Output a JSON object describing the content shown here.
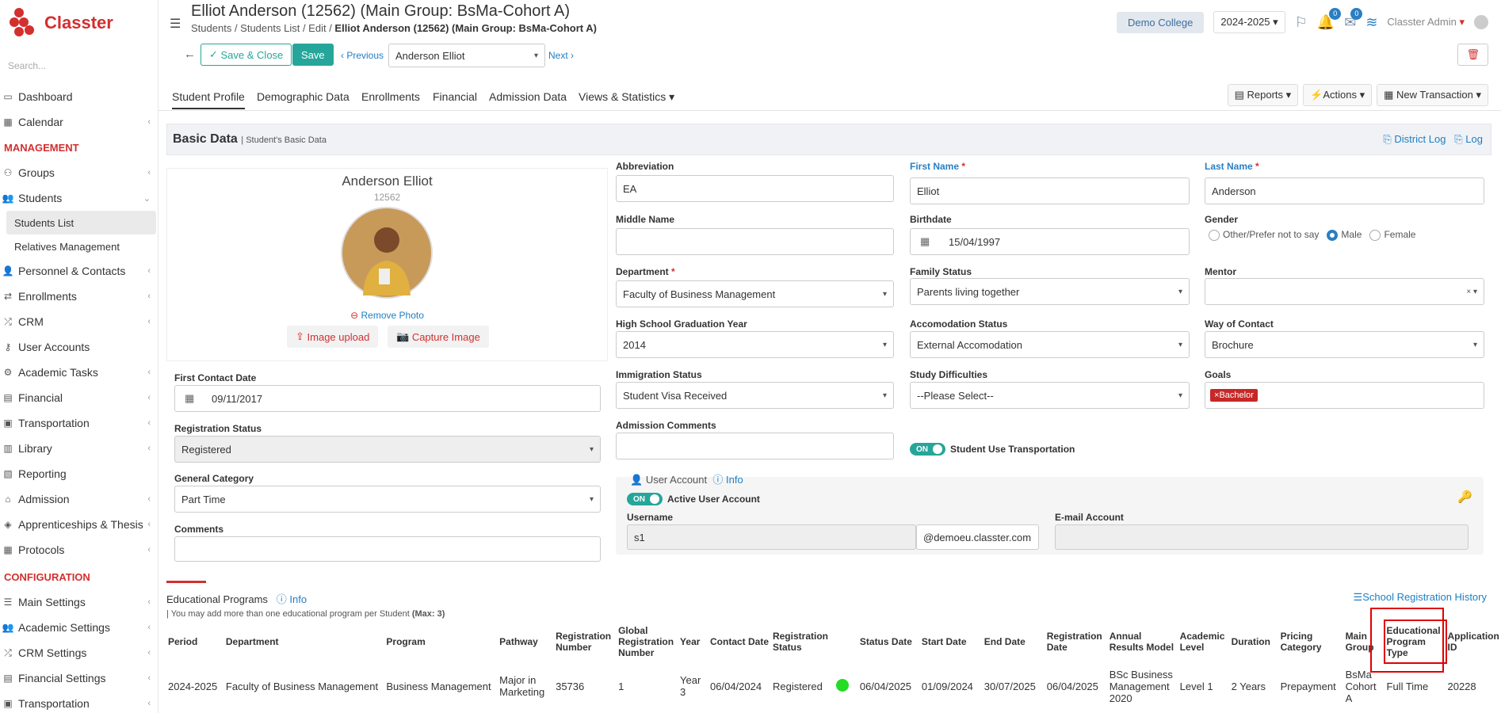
{
  "app": {
    "name": "Classter",
    "search_placeholder": "Search..."
  },
  "sidebar": {
    "items_top": [
      {
        "label": "Dashboard",
        "icon": "laptop-icon"
      },
      {
        "label": "Calendar",
        "icon": "calendar-icon"
      }
    ],
    "section1": "MANAGEMENT",
    "mgmt": [
      {
        "label": "Groups"
      },
      {
        "label": "Students"
      }
    ],
    "students_sub": [
      "Students List",
      "Relatives Management"
    ],
    "mgmt2": [
      "Personnel & Contacts",
      "Enrollments",
      "CRM",
      "User Accounts",
      "Academic Tasks",
      "Financial",
      "Transportation",
      "Library",
      "Reporting",
      "Admission",
      "Apprenticeships & Thesis",
      "Protocols"
    ],
    "section2": "CONFIGURATION",
    "config": [
      "Main Settings",
      "Academic Settings",
      "CRM Settings",
      "Financial Settings",
      "Transportation"
    ]
  },
  "header": {
    "title": "Elliot Anderson (12562) (Main Group: BsMa-Cohort A)",
    "crumbs": [
      "Students",
      "Students List",
      "Edit"
    ],
    "crumb_current": "Elliot Anderson (12562) (Main Group: BsMa-Cohort A)",
    "college": "Demo College",
    "year": "2024-2025",
    "notif1": "0",
    "notif2": "0",
    "user": "Classter Admin"
  },
  "toolbar": {
    "save_close": "Save & Close",
    "save": "Save",
    "previous": "Previous",
    "student": "Anderson Elliot",
    "next": "Next"
  },
  "tabs": [
    "Student Profile",
    "Demographic Data",
    "Enrollments",
    "Financial",
    "Admission Data",
    "Views & Statistics"
  ],
  "tab_buttons": [
    "Reports",
    "Actions",
    "New Transaction"
  ],
  "basic": {
    "title": "Basic Data",
    "subtitle": "| Student's Basic Data",
    "district_log": "District Log",
    "log": "Log"
  },
  "profile": {
    "name": "Anderson Elliot",
    "id": "12562",
    "remove": "Remove Photo",
    "upload": "Image upload",
    "capture": "Capture Image"
  },
  "left_form": {
    "first_contact_label": "First Contact Date",
    "first_contact": "09/11/2017",
    "reg_status_label": "Registration Status",
    "reg_status": "Registered",
    "gen_cat_label": "General Category",
    "gen_cat": "Part Time",
    "comments_label": "Comments"
  },
  "fields": {
    "abbr_label": "Abbreviation",
    "abbr": "EA",
    "first_label": "First Name",
    "first": "Elliot",
    "last_label": "Last Name",
    "last": "Anderson",
    "middle_label": "Middle Name",
    "birth_label": "Birthdate",
    "birth": "15/04/1997",
    "gender_label": "Gender",
    "gender_opts": [
      "Other/Prefer not to say",
      "Male",
      "Female"
    ],
    "dept_label": "Department",
    "dept": "Faculty of Business Management",
    "family_label": "Family Status",
    "family": "Parents living together",
    "mentor_label": "Mentor",
    "hs_label": "High School Graduation Year",
    "hs": "2014",
    "accom_label": "Accomodation Status",
    "accom": "External Accomodation",
    "contact_label": "Way of Contact",
    "contact": "Brochure",
    "immig_label": "Immigration Status",
    "immig": "Student Visa Received",
    "study_label": "Study Difficulties",
    "study": "--Please Select--",
    "goals_label": "Goals",
    "goals_tag": "Bachelor",
    "adm_comments_label": "Admission Comments",
    "transport_label": "Student Use Transportation",
    "on": "ON"
  },
  "ua": {
    "title": "User Account",
    "info": "Info",
    "active": "Active User Account",
    "username_label": "Username",
    "username": "s1",
    "domain": "@demoeu.classter.com",
    "email_label": "E-mail Account"
  },
  "programs": {
    "title": "Educational Programs",
    "info": "Info",
    "history": "School Registration History",
    "note": "| You may add more than one educational program per Student",
    "max": "(Max: 3)",
    "headers": [
      "Period",
      "Department",
      "Program",
      "Pathway",
      "Registration Number",
      "Global Registration Number",
      "Year",
      "Contact Date",
      "Registration Status",
      "",
      "Status Date",
      "Start Date",
      "End Date",
      "Registration Date",
      "Annual Results Model",
      "Academic Level",
      "Duration",
      "Pricing Category",
      "Main Group",
      "Educational Program Type",
      "Application ID"
    ],
    "row": [
      "2024-2025",
      "Faculty of Business Management",
      "Business Management",
      "Major in Marketing",
      "35736",
      "1",
      "Year 3",
      "06/04/2024",
      "Registered",
      "",
      "06/04/2025",
      "01/09/2024",
      "30/07/2025",
      "06/04/2025",
      "BSc Business Management 2020",
      "Level 1",
      "2 Years",
      "Prepayment",
      "BsMa Cohort A",
      "Full Time",
      "20228"
    ]
  },
  "colors": {
    "brand": "#d32f2f",
    "green": "#26a69a",
    "link": "#1e7fc3",
    "status_dot": "#22dd22",
    "highlight": "#e00000"
  }
}
